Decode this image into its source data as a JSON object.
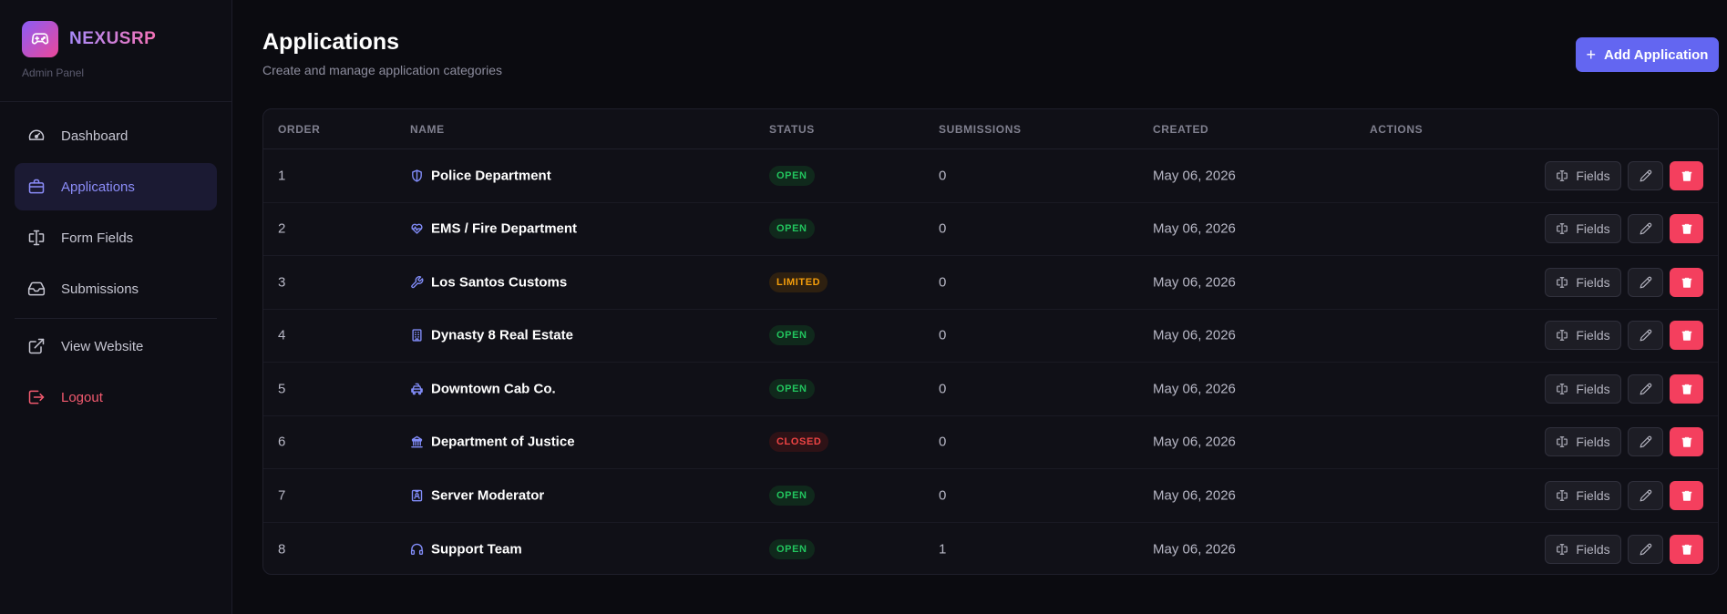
{
  "brand": {
    "name": "NEXUSRP",
    "subtitle": "Admin Panel"
  },
  "sidebar": {
    "items": [
      {
        "label": "Dashboard",
        "icon": "gauge-icon"
      },
      {
        "label": "Applications",
        "icon": "briefcase-icon",
        "active": true
      },
      {
        "label": "Form Fields",
        "icon": "form-input-icon"
      },
      {
        "label": "Submissions",
        "icon": "inbox-icon"
      },
      {
        "label": "View Website",
        "icon": "external-link-icon"
      },
      {
        "label": "Logout",
        "icon": "logout-icon"
      }
    ]
  },
  "header": {
    "title": "Applications",
    "subtitle": "Create and manage application categories",
    "add_button": "Add Application"
  },
  "table": {
    "columns": [
      "ORDER",
      "NAME",
      "STATUS",
      "SUBMISSIONS",
      "CREATED",
      "ACTIONS"
    ],
    "fields_label": "Fields",
    "rows": [
      {
        "order": "1",
        "name": "Police Department",
        "icon": "shield-icon",
        "status": "OPEN",
        "submissions": "0",
        "created": "May 06, 2026"
      },
      {
        "order": "2",
        "name": "EMS / Fire Department",
        "icon": "heart-pulse-icon",
        "status": "OPEN",
        "submissions": "0",
        "created": "May 06, 2026"
      },
      {
        "order": "3",
        "name": "Los Santos Customs",
        "icon": "wrench-icon",
        "status": "LIMITED",
        "submissions": "0",
        "created": "May 06, 2026"
      },
      {
        "order": "4",
        "name": "Dynasty 8 Real Estate",
        "icon": "building-icon",
        "status": "OPEN",
        "submissions": "0",
        "created": "May 06, 2026"
      },
      {
        "order": "5",
        "name": "Downtown Cab Co.",
        "icon": "taxi-icon",
        "status": "OPEN",
        "submissions": "0",
        "created": "May 06, 2026"
      },
      {
        "order": "6",
        "name": "Department of Justice",
        "icon": "landmark-icon",
        "status": "CLOSED",
        "submissions": "0",
        "created": "May 06, 2026"
      },
      {
        "order": "7",
        "name": "Server Moderator",
        "icon": "id-badge-icon",
        "status": "OPEN",
        "submissions": "0",
        "created": "May 06, 2026"
      },
      {
        "order": "8",
        "name": "Support Team",
        "icon": "headset-icon",
        "status": "OPEN",
        "submissions": "1",
        "created": "May 06, 2026"
      }
    ]
  },
  "colors": {
    "accent": "#6366f1",
    "open": "#22c55e",
    "limited": "#f59e0b",
    "closed": "#ef4444",
    "danger": "#f43f5e"
  }
}
